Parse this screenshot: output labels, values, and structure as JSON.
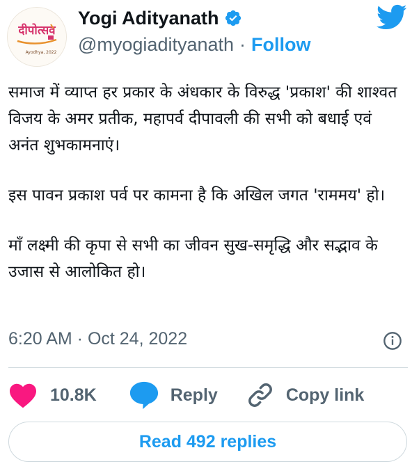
{
  "author": {
    "name": "Yogi Adityanath",
    "handle": "@myogiadityanath",
    "separator": "·",
    "follow_label": "Follow",
    "avatar_logo_text": "दीपोत्सव",
    "avatar_sub_text": "Ayodhya, 2022"
  },
  "tweet": {
    "paragraphs": [
      "समाज में व्याप्त हर प्रकार के अंधकार के विरुद्ध 'प्रकाश' की शाश्वत विजय के अमर प्रतीक, महापर्व दीपावली की सभी को बधाई एवं अनंत शुभकामनाएं।",
      "इस पावन प्रकाश पर्व पर कामना है कि अखिल जगत 'राममय' हो।",
      "माँ लक्ष्मी की कृपा से सभी का जीवन सुख-समृद्धि और सद्भाव के उजास से आलोकित हो।"
    ],
    "timestamp": "6:20 AM · Oct 24, 2022"
  },
  "actions": {
    "like_count": "10.8K",
    "reply_label": "Reply",
    "copy_label": "Copy link"
  },
  "read_replies_label": "Read 492 replies",
  "icons": {
    "verified": "verified-badge-icon",
    "logo": "twitter-bird-icon",
    "info": "info-icon",
    "like": "heart-icon",
    "reply": "speech-bubble-icon",
    "copy": "link-icon"
  },
  "colors": {
    "accent": "#1d9bf0",
    "like": "#f91880",
    "muted": "#536471",
    "text": "#0f1419",
    "border": "#cfd9de"
  }
}
